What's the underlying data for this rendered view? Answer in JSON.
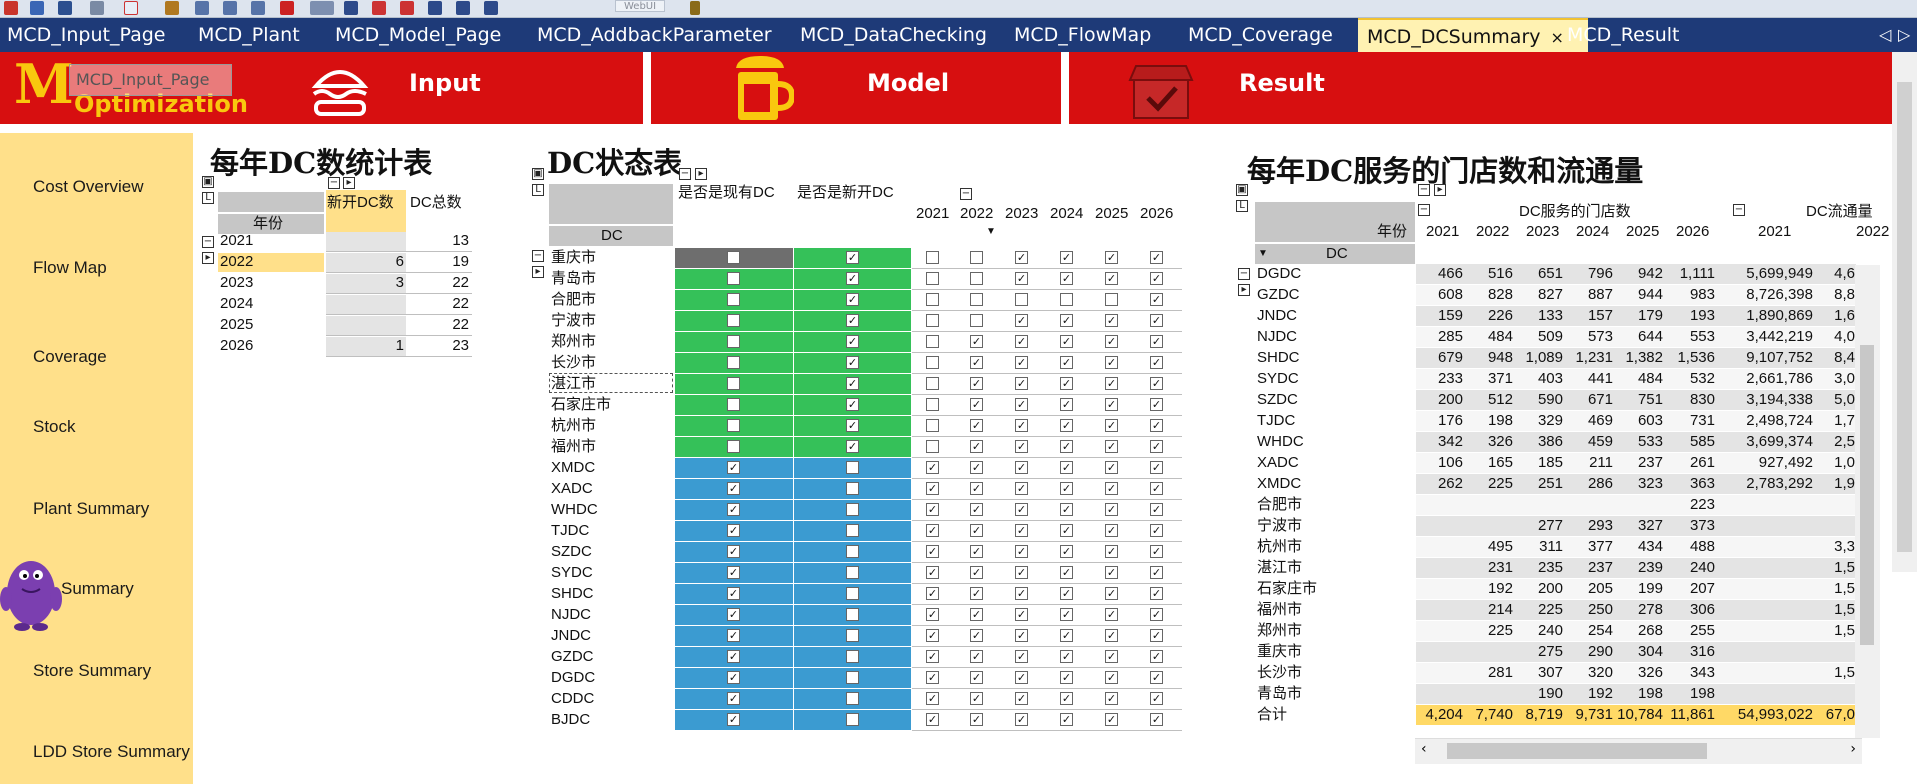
{
  "toolbar": {
    "web_label": "WebUI"
  },
  "tabs": [
    {
      "label": "MCD_Input_Page"
    },
    {
      "label": "MCD_Plant"
    },
    {
      "label": "MCD_Model_Page"
    },
    {
      "label": "MCD_AddbackParameter"
    },
    {
      "label": "MCD_DataChecking"
    },
    {
      "label": "MCD_FlowMap"
    },
    {
      "label": "MCD_Coverage"
    },
    {
      "label": "MCD_DCSummary",
      "close": "×"
    },
    {
      "label": "MCD_Result"
    }
  ],
  "tab_nav": {
    "prev": "◁",
    "next": "▷"
  },
  "banner": {
    "logo": "M",
    "brand_title": "Optimization",
    "tooltip": "MCD_Input_Page",
    "input_label": "Input",
    "model_label": "Model",
    "result_label": "Result",
    "colors": {
      "banner": "#d70f10",
      "brand": "#f9c80e",
      "tab_bar": "#1e3a78",
      "sidebar": "#ffe08a"
    }
  },
  "sidebar": {
    "items": [
      {
        "label": "Cost Overview"
      },
      {
        "label": "Flow Map"
      },
      {
        "label": "Coverage"
      },
      {
        "label": "Stock"
      },
      {
        "label": "Plant Summary"
      },
      {
        "label": "Summary"
      },
      {
        "label": "Store Summary"
      },
      {
        "label": "LDD Store Summary"
      }
    ]
  },
  "dc_count": {
    "title": "每年DC数统计表",
    "col_new": "新开DC数",
    "col_total": "DC总数",
    "row_header": "年份",
    "rows": [
      {
        "year": "2021",
        "new": "",
        "total": "13"
      },
      {
        "year": "2022",
        "new": "6",
        "total": "19"
      },
      {
        "year": "2023",
        "new": "3",
        "total": "22"
      },
      {
        "year": "2024",
        "new": "",
        "total": "22"
      },
      {
        "year": "2025",
        "new": "",
        "total": "22"
      },
      {
        "year": "2026",
        "new": "1",
        "total": "23"
      }
    ]
  },
  "dc_status": {
    "title": "DC状态表",
    "col_existing": "是否是现有DC",
    "col_new": "是否是新开DC",
    "row_header": "DC",
    "years": [
      "2021",
      "2022",
      "2023",
      "2024",
      "2025",
      "2026"
    ],
    "rows": [
      {
        "name": "重庆市",
        "existing": false,
        "new": true,
        "y": [
          false,
          false,
          true,
          true,
          true,
          true
        ],
        "color": "gray"
      },
      {
        "name": "青岛市",
        "existing": false,
        "new": true,
        "y": [
          false,
          false,
          true,
          true,
          true,
          true
        ],
        "color": "green"
      },
      {
        "name": "合肥市",
        "existing": false,
        "new": true,
        "y": [
          false,
          false,
          false,
          false,
          false,
          true
        ],
        "color": "green"
      },
      {
        "name": "宁波市",
        "existing": false,
        "new": true,
        "y": [
          false,
          false,
          true,
          true,
          true,
          true
        ],
        "color": "green"
      },
      {
        "name": "郑州市",
        "existing": false,
        "new": true,
        "y": [
          false,
          true,
          true,
          true,
          true,
          true
        ],
        "color": "green"
      },
      {
        "name": "长沙市",
        "existing": false,
        "new": true,
        "y": [
          false,
          true,
          true,
          true,
          true,
          true
        ],
        "color": "green"
      },
      {
        "name": "湛江市",
        "existing": false,
        "new": true,
        "y": [
          false,
          true,
          true,
          true,
          true,
          true
        ],
        "color": "green"
      },
      {
        "name": "石家庄市",
        "existing": false,
        "new": true,
        "y": [
          false,
          true,
          true,
          true,
          true,
          true
        ],
        "color": "green"
      },
      {
        "name": "杭州市",
        "existing": false,
        "new": true,
        "y": [
          false,
          true,
          true,
          true,
          true,
          true
        ],
        "color": "green"
      },
      {
        "name": "福州市",
        "existing": false,
        "new": true,
        "y": [
          false,
          true,
          true,
          true,
          true,
          true
        ],
        "color": "green"
      },
      {
        "name": "XMDC",
        "existing": true,
        "new": false,
        "y": [
          true,
          true,
          true,
          true,
          true,
          true
        ],
        "color": "blue"
      },
      {
        "name": "XADC",
        "existing": true,
        "new": false,
        "y": [
          true,
          true,
          true,
          true,
          true,
          true
        ],
        "color": "blue"
      },
      {
        "name": "WHDC",
        "existing": true,
        "new": false,
        "y": [
          true,
          true,
          true,
          true,
          true,
          true
        ],
        "color": "blue"
      },
      {
        "name": "TJDC",
        "existing": true,
        "new": false,
        "y": [
          true,
          true,
          true,
          true,
          true,
          true
        ],
        "color": "blue"
      },
      {
        "name": "SZDC",
        "existing": true,
        "new": false,
        "y": [
          true,
          true,
          true,
          true,
          true,
          true
        ],
        "color": "blue"
      },
      {
        "name": "SYDC",
        "existing": true,
        "new": false,
        "y": [
          true,
          true,
          true,
          true,
          true,
          true
        ],
        "color": "blue"
      },
      {
        "name": "SHDC",
        "existing": true,
        "new": false,
        "y": [
          true,
          true,
          true,
          true,
          true,
          true
        ],
        "color": "blue"
      },
      {
        "name": "NJDC",
        "existing": true,
        "new": false,
        "y": [
          true,
          true,
          true,
          true,
          true,
          true
        ],
        "color": "blue"
      },
      {
        "name": "JNDC",
        "existing": true,
        "new": false,
        "y": [
          true,
          true,
          true,
          true,
          true,
          true
        ],
        "color": "blue"
      },
      {
        "name": "GZDC",
        "existing": true,
        "new": false,
        "y": [
          true,
          true,
          true,
          true,
          true,
          true
        ],
        "color": "blue"
      },
      {
        "name": "DGDC",
        "existing": true,
        "new": false,
        "y": [
          true,
          true,
          true,
          true,
          true,
          true
        ],
        "color": "blue"
      },
      {
        "name": "CDDC",
        "existing": true,
        "new": false,
        "y": [
          true,
          true,
          true,
          true,
          true,
          true
        ],
        "color": "blue"
      },
      {
        "name": "BJDC",
        "existing": true,
        "new": false,
        "y": [
          true,
          true,
          true,
          true,
          true,
          true
        ],
        "color": "blue"
      }
    ],
    "colors": {
      "gray": "#6e6e6e",
      "green": "#35c159",
      "blue": "#3b9bd1"
    }
  },
  "dc_service": {
    "title": "每年DC服务的门店数和流通量",
    "group_stores": "DC服务的门店数",
    "group_flow": "DC流通量",
    "row_header": "年份",
    "dc_header": "DC",
    "years": [
      "2021",
      "2022",
      "2023",
      "2024",
      "2025",
      "2026"
    ],
    "flow_years": [
      "2021",
      "2022"
    ],
    "rows": [
      {
        "name": "DGDC",
        "s": [
          "466",
          "516",
          "651",
          "796",
          "942",
          "1,111"
        ],
        "f": [
          "5,699,949",
          "4,6"
        ]
      },
      {
        "name": "GZDC",
        "s": [
          "608",
          "828",
          "827",
          "887",
          "944",
          "983"
        ],
        "f": [
          "8,726,398",
          "8,8"
        ]
      },
      {
        "name": "JNDC",
        "s": [
          "159",
          "226",
          "133",
          "157",
          "179",
          "193"
        ],
        "f": [
          "1,890,869",
          "1,6"
        ]
      },
      {
        "name": "NJDC",
        "s": [
          "285",
          "484",
          "509",
          "573",
          "644",
          "553"
        ],
        "f": [
          "3,442,219",
          "4,0"
        ]
      },
      {
        "name": "SHDC",
        "s": [
          "679",
          "948",
          "1,089",
          "1,231",
          "1,382",
          "1,536"
        ],
        "f": [
          "9,107,752",
          "8,4"
        ]
      },
      {
        "name": "SYDC",
        "s": [
          "233",
          "371",
          "403",
          "441",
          "484",
          "532"
        ],
        "f": [
          "2,661,786",
          "3,0"
        ]
      },
      {
        "name": "SZDC",
        "s": [
          "200",
          "512",
          "590",
          "671",
          "751",
          "830"
        ],
        "f": [
          "3,194,338",
          "5,0"
        ]
      },
      {
        "name": "TJDC",
        "s": [
          "176",
          "198",
          "329",
          "469",
          "603",
          "731"
        ],
        "f": [
          "2,498,724",
          "1,7"
        ]
      },
      {
        "name": "WHDC",
        "s": [
          "342",
          "326",
          "386",
          "459",
          "533",
          "585"
        ],
        "f": [
          "3,699,374",
          "2,5"
        ]
      },
      {
        "name": "XADC",
        "s": [
          "106",
          "165",
          "185",
          "211",
          "237",
          "261"
        ],
        "f": [
          "927,492",
          "1,0"
        ]
      },
      {
        "name": "XMDC",
        "s": [
          "262",
          "225",
          "251",
          "286",
          "323",
          "363"
        ],
        "f": [
          "2,783,292",
          "1,9"
        ]
      },
      {
        "name": "合肥市",
        "s": [
          "",
          "",
          "",
          "",
          "",
          "223"
        ],
        "f": [
          "",
          ""
        ]
      },
      {
        "name": "宁波市",
        "s": [
          "",
          "",
          "277",
          "293",
          "327",
          "373"
        ],
        "f": [
          "",
          ""
        ]
      },
      {
        "name": "杭州市",
        "s": [
          "",
          "495",
          "311",
          "377",
          "434",
          "488"
        ],
        "f": [
          "",
          "3,3"
        ]
      },
      {
        "name": "湛江市",
        "s": [
          "",
          "231",
          "235",
          "237",
          "239",
          "240"
        ],
        "f": [
          "",
          "1,5"
        ]
      },
      {
        "name": "石家庄市",
        "s": [
          "",
          "192",
          "200",
          "205",
          "199",
          "207"
        ],
        "f": [
          "",
          "1,5"
        ]
      },
      {
        "name": "福州市",
        "s": [
          "",
          "214",
          "225",
          "250",
          "278",
          "306"
        ],
        "f": [
          "",
          "1,5"
        ]
      },
      {
        "name": "郑州市",
        "s": [
          "",
          "225",
          "240",
          "254",
          "268",
          "255"
        ],
        "f": [
          "",
          "1,5"
        ]
      },
      {
        "name": "重庆市",
        "s": [
          "",
          "",
          "275",
          "290",
          "304",
          "316"
        ],
        "f": [
          "",
          ""
        ]
      },
      {
        "name": "长沙市",
        "s": [
          "",
          "281",
          "307",
          "320",
          "326",
          "343"
        ],
        "f": [
          "",
          "1,5"
        ]
      },
      {
        "name": "青岛市",
        "s": [
          "",
          "",
          "190",
          "192",
          "198",
          "198"
        ],
        "f": [
          "",
          ""
        ]
      }
    ],
    "total": {
      "name": "合计",
      "s": [
        "4,204",
        "7,740",
        "8,719",
        "9,731",
        "10,784",
        "11,861"
      ],
      "f": [
        "54,993,022",
        "67,0"
      ]
    }
  }
}
